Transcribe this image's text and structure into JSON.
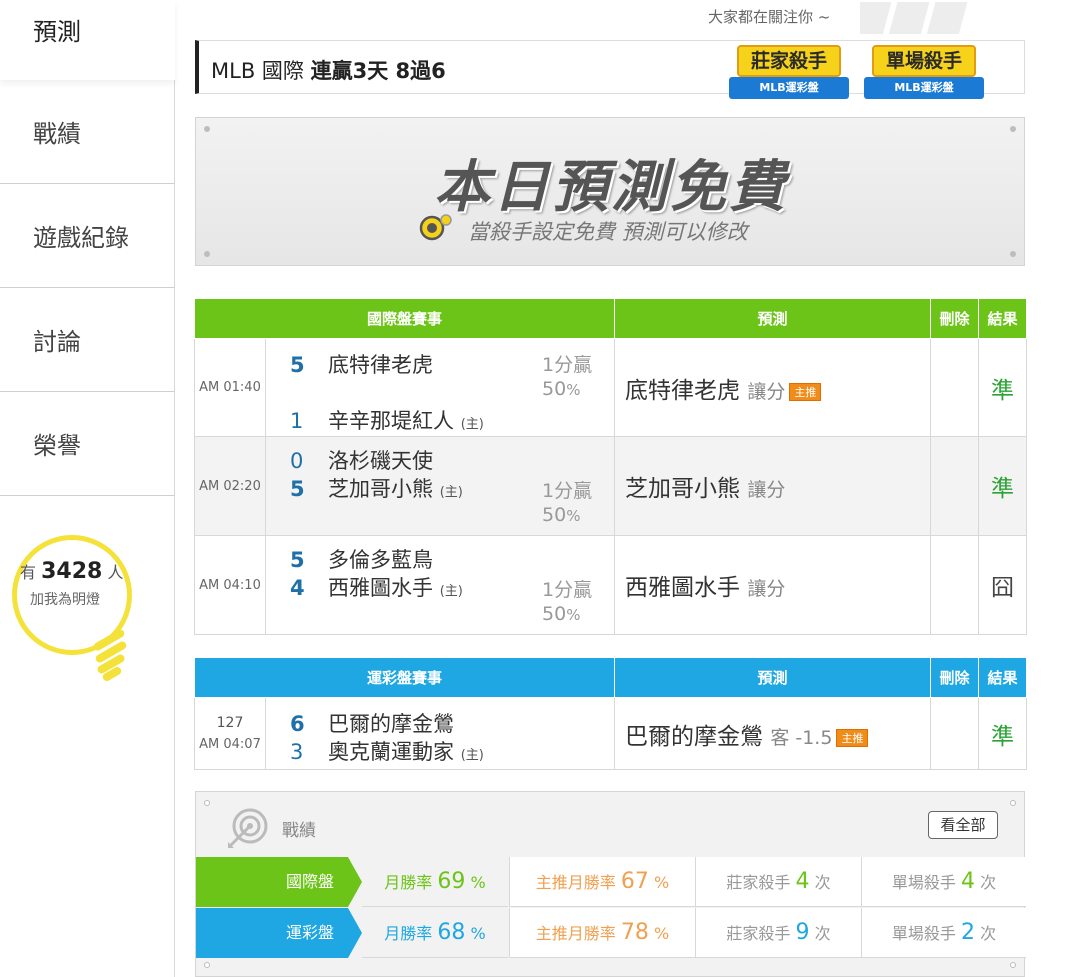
{
  "sidebar": {
    "items": [
      {
        "label": "預測"
      },
      {
        "label": "戰績"
      },
      {
        "label": "遊戲紀錄"
      },
      {
        "label": "討論"
      },
      {
        "label": "榮譽"
      }
    ],
    "fans": {
      "prefix": "有",
      "count": "3428",
      "suffix": "人",
      "cta": "加我為明燈"
    }
  },
  "header": {
    "tagline": "大家都在關注你 ~",
    "league": "MLB 國際",
    "streak": "連贏3天 8過6",
    "badges": [
      {
        "title": "莊家殺手",
        "ribbon": "MLB運彩盤"
      },
      {
        "title": "單場殺手",
        "ribbon": "MLB運彩盤"
      }
    ]
  },
  "banner": {
    "title": "本日預測免費",
    "subtitle": "當殺手設定免費 預測可以修改"
  },
  "intl_table": {
    "headers": {
      "match": "國際盤賽事",
      "pick": "預測",
      "delete": "刪除",
      "result": "結果"
    },
    "rows": [
      {
        "time": "AM 01:40",
        "away_score": "5",
        "away": "底特律老虎",
        "home_score": "1",
        "home": "辛辛那堤紅人",
        "home_mark": "(主)",
        "spread_top": "1分贏",
        "spread_pct": "50",
        "pct_sign": "%",
        "pick": "底特律老虎",
        "pick_type": "讓分",
        "main_tag": "主推",
        "result": "準"
      },
      {
        "time": "AM 02:20",
        "away_score": "0",
        "away": "洛杉磯天使",
        "home_score": "5",
        "home": "芝加哥小熊",
        "home_mark": "(主)",
        "spread_top": "1分贏",
        "spread_pct": "50",
        "pct_sign": "%",
        "pick": "芝加哥小熊",
        "pick_type": "讓分",
        "main_tag": "",
        "result": "準"
      },
      {
        "time": "AM 04:10",
        "away_score": "5",
        "away": "多倫多藍鳥",
        "home_score": "4",
        "home": "西雅圖水手",
        "home_mark": "(主)",
        "spread_top": "1分贏",
        "spread_pct": "50",
        "pct_sign": "%",
        "pick": "西雅圖水手",
        "pick_type": "讓分",
        "main_tag": "",
        "result": "囧"
      }
    ]
  },
  "sports_table": {
    "headers": {
      "match": "運彩盤賽事",
      "pick": "預測",
      "delete": "刪除",
      "result": "結果"
    },
    "rows": [
      {
        "game_no": "127",
        "time": "AM 04:07",
        "away_score": "6",
        "away": "巴爾的摩金鶯",
        "home_score": "3",
        "home": "奧克蘭運動家",
        "home_mark": "(主)",
        "pick": "巴爾的摩金鶯",
        "pick_type": "客 -1.5",
        "main_tag": "主推",
        "result": "準"
      }
    ]
  },
  "record": {
    "title": "戰績",
    "view_all": "看全部",
    "rows": [
      {
        "label": "國際盤",
        "color": "#6cc418",
        "month_label": "月勝率",
        "month_rate": "69",
        "main_label": "主推月勝率",
        "main_rate": "67",
        "pct": "%",
        "banker_label": "莊家殺手",
        "banker_count": "4",
        "single_label": "單場殺手",
        "single_count": "4",
        "times": "次"
      },
      {
        "label": "運彩盤",
        "color": "#1ea7e2",
        "month_label": "月勝率",
        "month_rate": "68",
        "main_label": "主推月勝率",
        "main_rate": "78",
        "pct": "%",
        "banker_label": "莊家殺手",
        "banker_count": "9",
        "single_label": "單場殺手",
        "single_count": "2",
        "times": "次"
      }
    ]
  }
}
